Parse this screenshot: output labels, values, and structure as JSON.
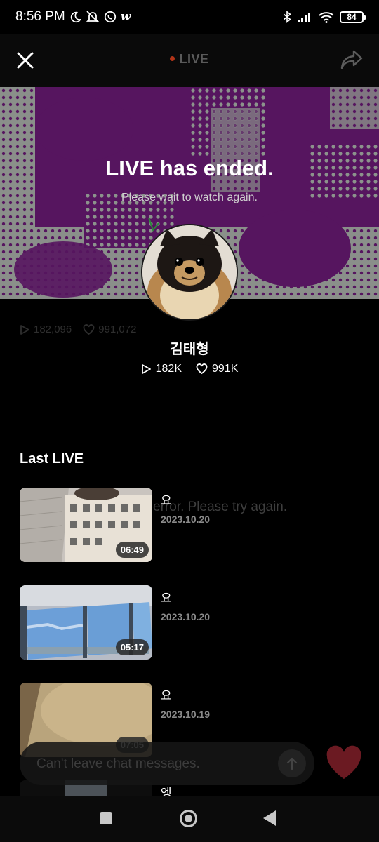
{
  "status_bar": {
    "time": "8:56 PM",
    "left_icons": [
      "moon-icon",
      "bell-off-icon",
      "whatsapp-icon",
      "w-app-icon"
    ],
    "right_icons": [
      "bluetooth-icon",
      "signal-icon",
      "wifi-icon"
    ],
    "battery": "84"
  },
  "header": {
    "title": "LIVE",
    "live_dot_color": "#b23418"
  },
  "banner": {
    "title": "LIVE has ended.",
    "subtitle": "Please wait to watch again.",
    "background_color": "#56155f"
  },
  "ghost_stats": {
    "views": "182,096",
    "likes": "991,072"
  },
  "profile": {
    "name": "김태형",
    "views": "182K",
    "likes": "991K"
  },
  "last_live": {
    "section_title": "Last LIVE",
    "background_message": "error. Please try again.",
    "items": [
      {
        "title": "요",
        "date": "2023.10.20",
        "duration": "06:49"
      },
      {
        "title": "요",
        "date": "2023.10.20",
        "duration": "05:17"
      },
      {
        "title": "요",
        "date": "2023.10.19",
        "duration": "07:05"
      },
      {
        "title": "엥",
        "date": "",
        "duration": ""
      }
    ]
  },
  "chat": {
    "placeholder": "Can't leave chat messages."
  },
  "colors": {
    "accent_heart": "#6b1a22",
    "background": "#000000"
  }
}
